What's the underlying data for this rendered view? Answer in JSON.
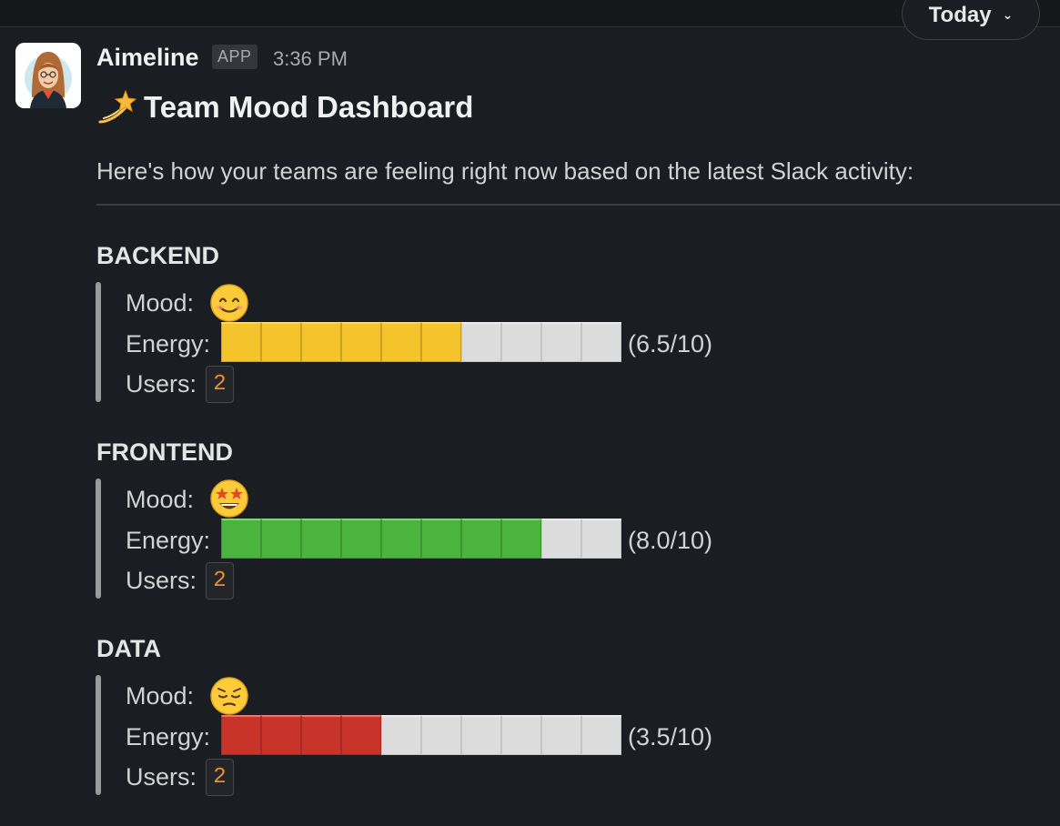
{
  "date_divider": {
    "label": "Today"
  },
  "message": {
    "sender": "Aimeline",
    "badge": "APP",
    "time": "3:36 PM",
    "title": "Team Mood Dashboard",
    "title_icon": "dizzy-star-emoji",
    "intro": "Here's how your teams are feeling right now based on the latest Slack activity:"
  },
  "labels": {
    "mood": "Mood:",
    "energy": "Energy:",
    "users": "Users:"
  },
  "teams": [
    {
      "name": "BACKEND",
      "mood_icon": "smiling-face-emoji",
      "energy_score": "(6.5/10)",
      "energy_value": 6.5,
      "energy_filled_segments": 6,
      "energy_total_segments": 10,
      "bar_color": "#f5c42c",
      "users": "2"
    },
    {
      "name": "FRONTEND",
      "mood_icon": "star-struck-emoji",
      "energy_score": "(8.0/10)",
      "energy_value": 8.0,
      "energy_filled_segments": 8,
      "energy_total_segments": 10,
      "bar_color": "#4ab43e",
      "users": "2"
    },
    {
      "name": "DATA",
      "mood_icon": "pensive-face-emoji",
      "energy_score": "(3.5/10)",
      "energy_value": 3.5,
      "energy_filled_segments": 4,
      "energy_total_segments": 10,
      "bar_color": "#c8342a",
      "users": "2"
    }
  ],
  "colors": {
    "background": "#1a1d21",
    "text": "#d1d2d3",
    "users_count": "#e8912d",
    "empty_segment": "#dcdcdc"
  }
}
